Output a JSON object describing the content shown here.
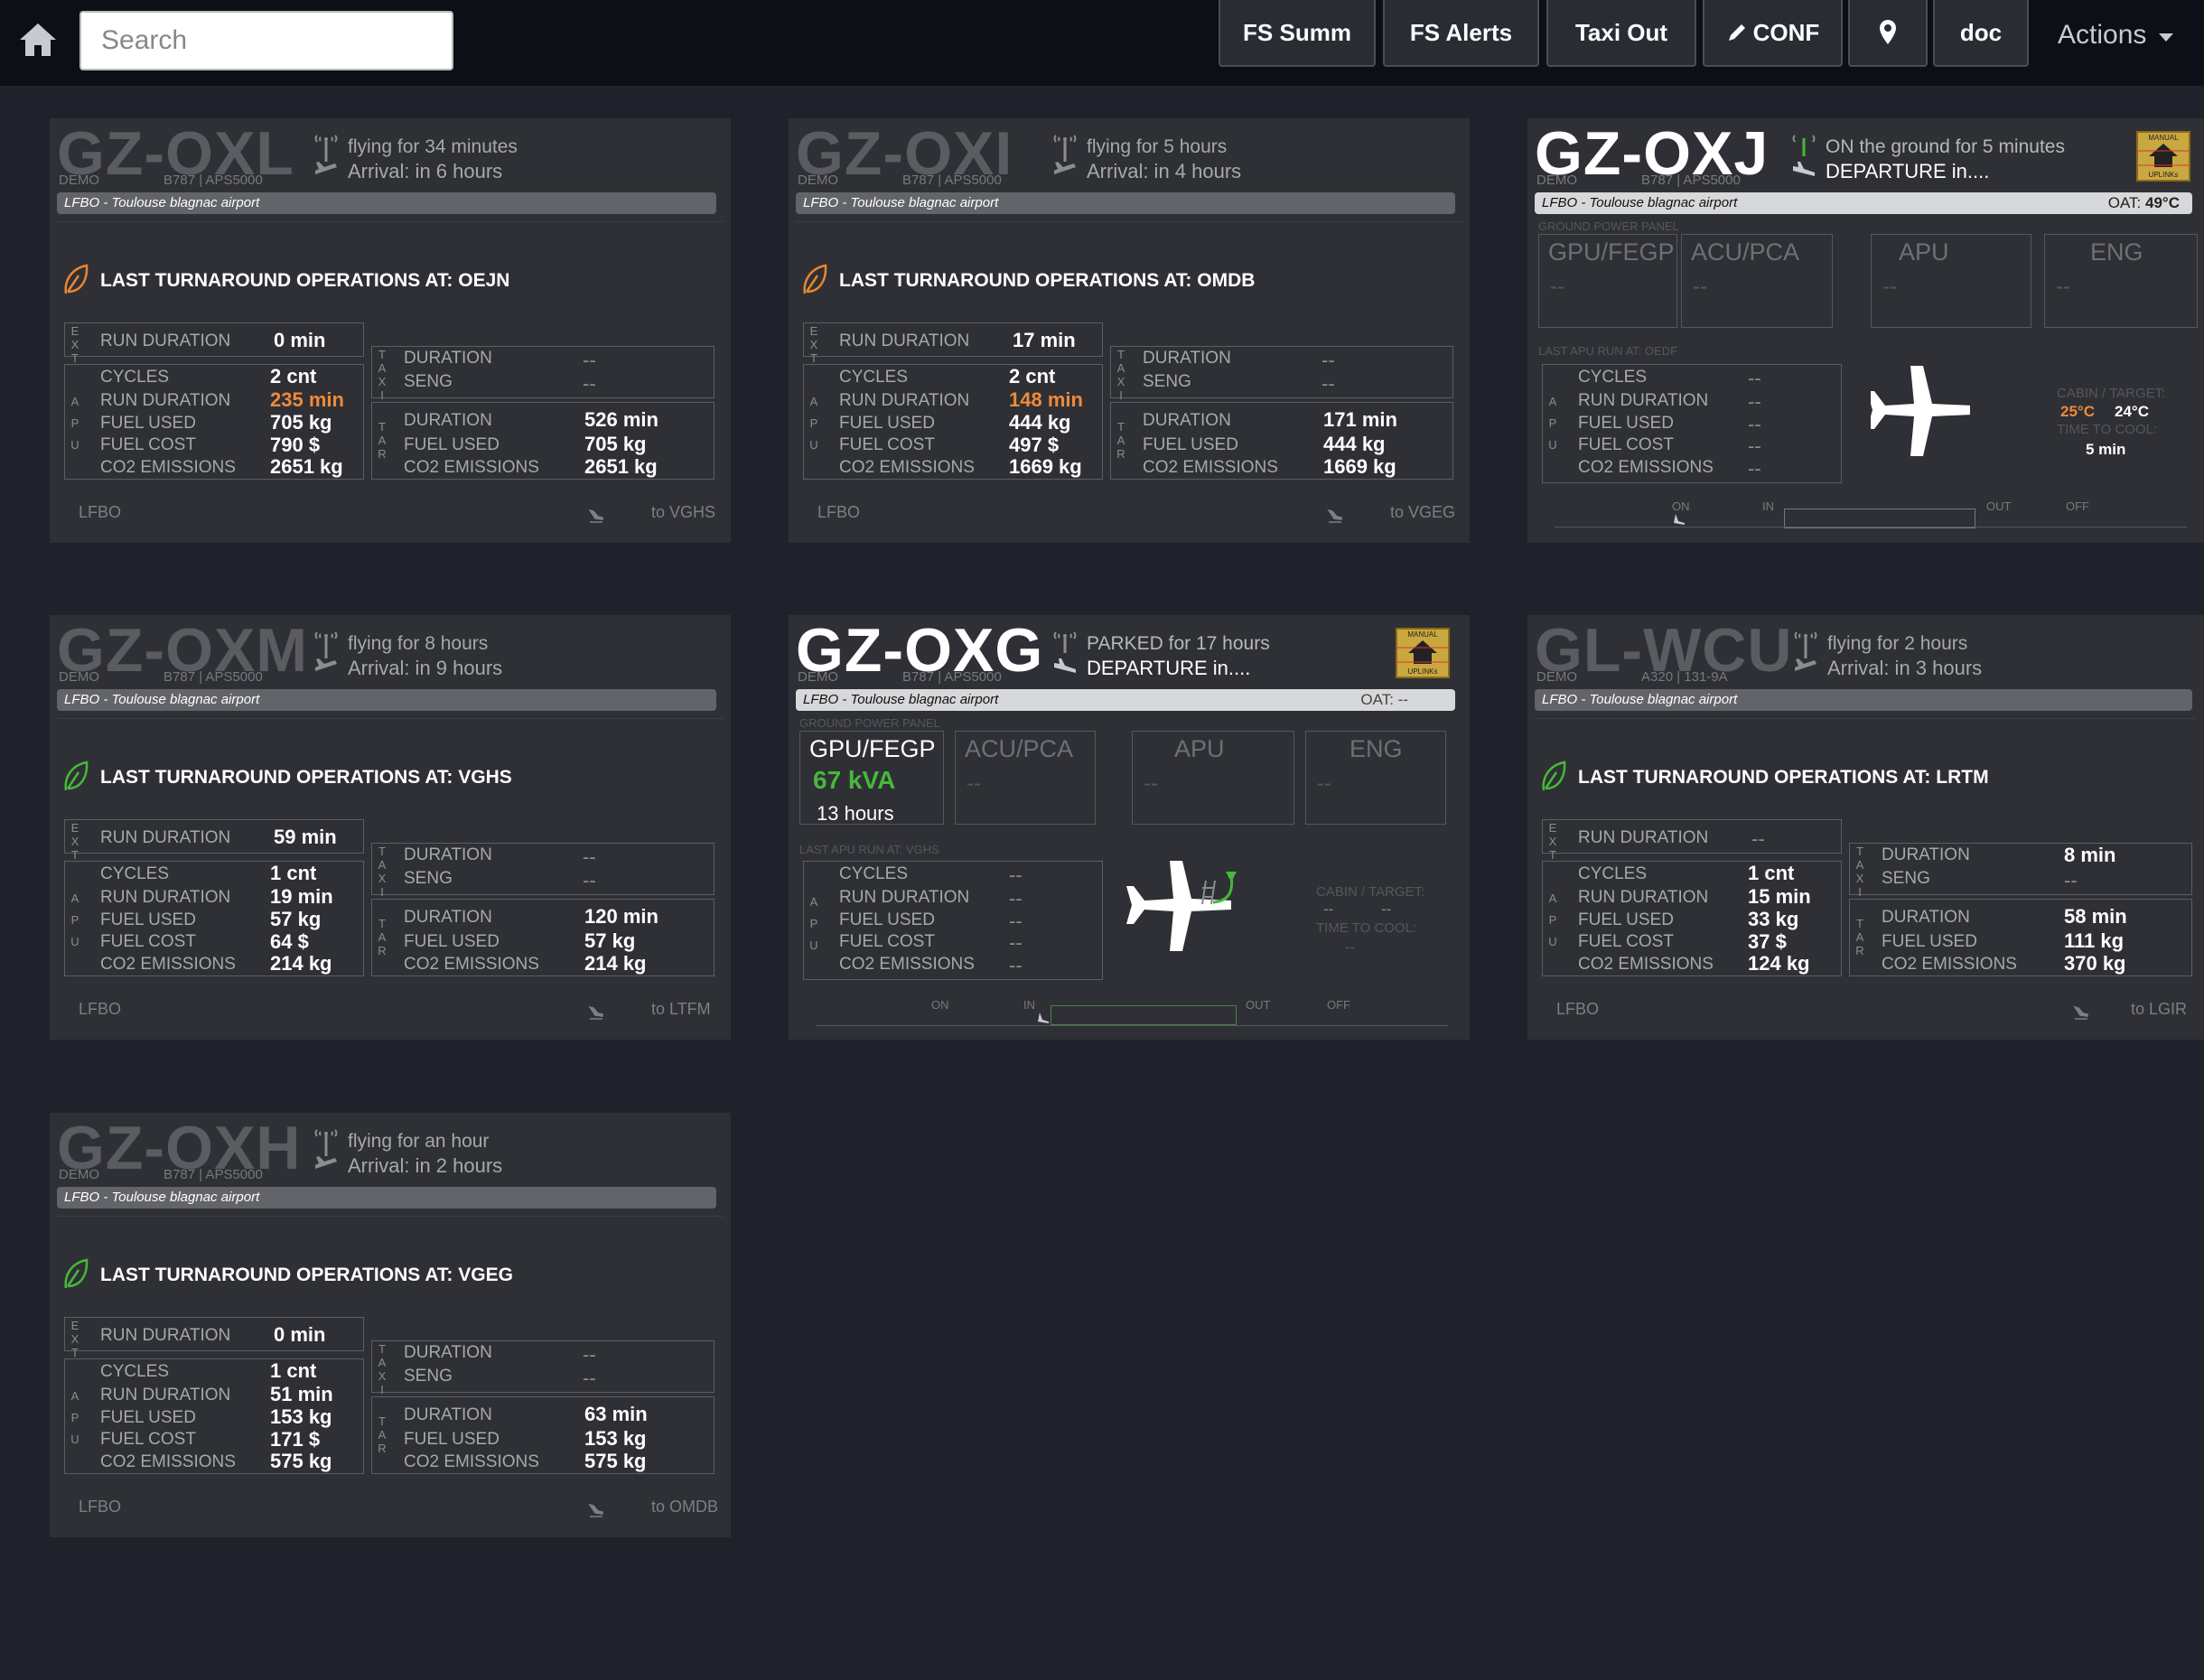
{
  "toolbar": {
    "search_placeholder": "Search",
    "buttons": [
      "FS Summ",
      "FS Alerts",
      "Taxi Out",
      "CONF",
      "doc"
    ],
    "actions_label": "Actions"
  },
  "labels": {
    "lto_prefix": "LAST TURNAROUND OPERATIONS AT: ",
    "run_duration": "RUN DURATION",
    "cycles": "CYCLES",
    "fuel_used": "FUEL USED",
    "fuel_cost": "FUEL COST",
    "co2": "CO2 EMISSIONS",
    "duration": "DURATION",
    "seng": "SENG",
    "demo": "DEMO",
    "ground_power_panel": "GROUND POWER PANEL",
    "gpu": "GPU/FEGP",
    "acu": "ACU/PCA",
    "apu": "APU",
    "eng": "ENG",
    "cabin_target": "CABIN / TARGET:",
    "time_to_cool": "TIME TO COOL:",
    "tl_on": "ON",
    "tl_in": "IN",
    "tl_out": "OUT",
    "tl_off": "OFF",
    "oat": "OAT:",
    "manual": "MANUAL",
    "uplinks": "UPLINKs"
  },
  "cards": [
    {
      "reg": "GZ-OXL",
      "model": "B787 | APS5000",
      "status1": "flying for 34 minutes",
      "status2": "Arrival: in 6 hours",
      "airport": "LFBO - Toulouse blagnac airport",
      "lto": "LAST TURNAROUND OPERATIONS AT: OEJN",
      "ext_run": "0 min",
      "apu": {
        "cycles": "2 cnt",
        "run": "235 min",
        "fuel": "705 kg",
        "cost": "790 $",
        "co2": "2651 kg"
      },
      "taxi": {
        "duration": "--",
        "seng": "--"
      },
      "tar": {
        "duration": "526 min",
        "fuel": "705 kg",
        "co2": "2651 kg"
      },
      "from": "LFBO",
      "to": "to VGHS"
    },
    {
      "reg": "GZ-OXI",
      "model": "B787 | APS5000",
      "status1": "flying for 5 hours",
      "status2": "Arrival: in 4 hours",
      "airport": "LFBO - Toulouse blagnac airport",
      "lto": "LAST TURNAROUND OPERATIONS AT: OMDB",
      "ext_run": "17 min",
      "apu": {
        "cycles": "2 cnt",
        "run": "148 min",
        "fuel": "444 kg",
        "cost": "497 $",
        "co2": "1669 kg"
      },
      "taxi": {
        "duration": "--",
        "seng": "--"
      },
      "tar": {
        "duration": "171 min",
        "fuel": "444 kg",
        "co2": "1669 kg"
      },
      "from": "LFBO",
      "to": "to VGEG"
    },
    {
      "reg": "GZ-OXJ",
      "model": "B787 | APS5000",
      "status1": "ON the ground for 5 minutes",
      "status2": "DEPARTURE in....",
      "airport": "LFBO - Toulouse blagnac airport",
      "oat": "49°C",
      "apu_last": "LAST APU RUN AT: OEDF",
      "apu": {
        "cycles": "--",
        "run": "--",
        "fuel": "--",
        "cost": "--",
        "co2": "--"
      },
      "cabin": "25°C",
      "target": "24°C",
      "cool": "5 min",
      "gpu_dash": "--",
      "acu_dash": "--",
      "apu_dash": "--",
      "eng_dash": "--"
    },
    {
      "reg": "GZ-OXM",
      "model": "B787 | APS5000",
      "status1": "flying for 8 hours",
      "status2": "Arrival: in 9 hours",
      "airport": "LFBO - Toulouse blagnac airport",
      "lto": "LAST TURNAROUND OPERATIONS AT: VGHS",
      "ext_run": "59 min",
      "apu": {
        "cycles": "1 cnt",
        "run": "19 min",
        "fuel": "57 kg",
        "cost": "64 $",
        "co2": "214 kg"
      },
      "taxi": {
        "duration": "--",
        "seng": "--"
      },
      "tar": {
        "duration": "120 min",
        "fuel": "57 kg",
        "co2": "214 kg"
      },
      "from": "LFBO",
      "to": "to LTFM"
    },
    {
      "reg": "GZ-OXG",
      "model": "B787 | APS5000",
      "status1": "PARKED for 17 hours",
      "status2": "DEPARTURE in....",
      "airport": "LFBO - Toulouse blagnac airport",
      "oat": "--",
      "gpu_kva": "67 kVA",
      "gpu_hours": "13 hours",
      "apu_last": "LAST APU RUN AT: VGHS",
      "apu": {
        "cycles": "--",
        "run": "--",
        "fuel": "--",
        "cost": "--",
        "co2": "--"
      },
      "cabin": "--",
      "target": "--",
      "cool": "--",
      "acu_dash": "--",
      "apu_dash": "--",
      "eng_dash": "--"
    },
    {
      "reg": "GL-WCU",
      "model": "A320 | 131-9A",
      "status1": "flying for 2 hours",
      "status2": "Arrival: in 3 hours",
      "airport": "LFBO - Toulouse blagnac airport",
      "lto": "LAST TURNAROUND OPERATIONS AT: LRTM",
      "ext_run": "--",
      "apu": {
        "cycles": "1 cnt",
        "run": "15 min",
        "fuel": "33 kg",
        "cost": "37 $",
        "co2": "124 kg"
      },
      "taxi": {
        "duration": "8 min",
        "seng": "--"
      },
      "tar": {
        "duration": "58 min",
        "fuel": "111 kg",
        "co2": "370 kg"
      },
      "from": "LFBO",
      "to": "to LGIR"
    },
    {
      "reg": "GZ-OXH",
      "model": "B787 | APS5000",
      "status1": "flying for an hour",
      "status2": "Arrival: in 2 hours",
      "airport": "LFBO - Toulouse blagnac airport",
      "lto": "LAST TURNAROUND OPERATIONS AT: VGEG",
      "ext_run": "0 min",
      "apu": {
        "cycles": "1 cnt",
        "run": "51 min",
        "fuel": "153 kg",
        "cost": "171 $",
        "co2": "575 kg"
      },
      "taxi": {
        "duration": "--",
        "seng": "--"
      },
      "tar": {
        "duration": "63 min",
        "fuel": "153 kg",
        "co2": "575 kg"
      },
      "from": "LFBO",
      "to": "to OMDB"
    }
  ]
}
